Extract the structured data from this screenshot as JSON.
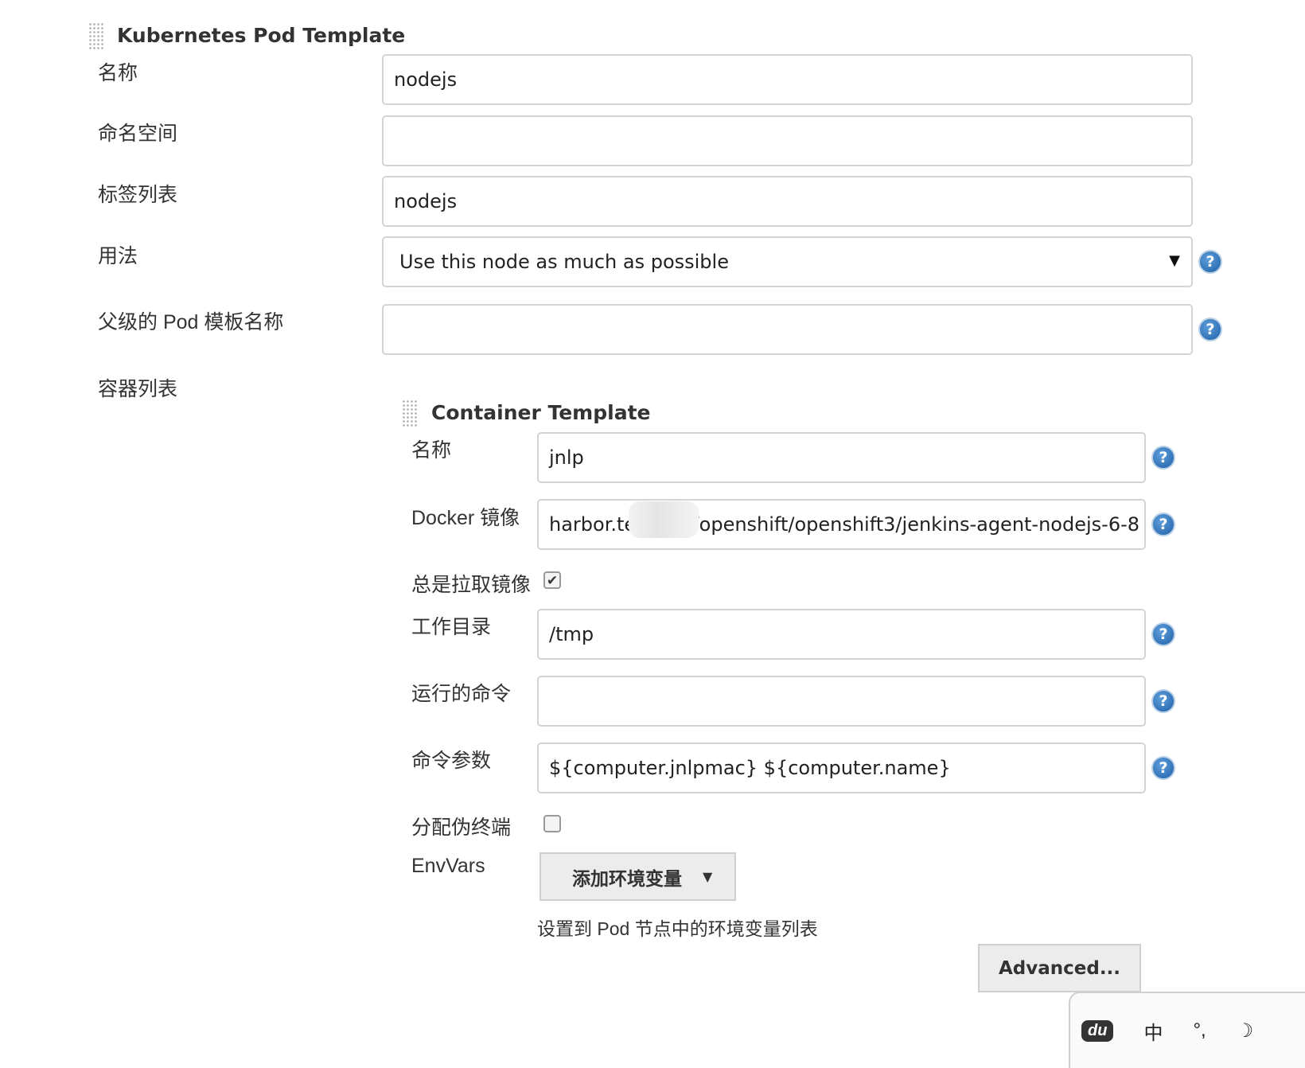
{
  "pod_template": {
    "title": "Kubernetes Pod Template",
    "name_label": "名称",
    "name_value": "nodejs",
    "namespace_label": "命名空间",
    "namespace_value": "",
    "labels_label": "标签列表",
    "labels_value": "nodejs",
    "usage_label": "用法",
    "usage_value": "Use this node as much as possible",
    "parent_label": "父级的 Pod 模板名称",
    "parent_value": "",
    "containers_label": "容器列表"
  },
  "container_template": {
    "title": "Container Template",
    "name_label": "名称",
    "name_value": "jnlp",
    "image_label": "Docker 镜像",
    "image_value": "harbor.tes        com/openshift/openshift3/jenkins-agent-nodejs-6-8",
    "always_pull_label": "总是拉取镜像",
    "always_pull_checked": true,
    "workdir_label": "工作目录",
    "workdir_value": "/tmp",
    "command_label": "运行的命令",
    "command_value": "",
    "args_label": "命令参数",
    "args_value": "${computer.jnlpmac} ${computer.name}",
    "tty_label": "分配伪终端",
    "tty_checked": false,
    "envvars_label": "EnvVars",
    "add_env_button": "添加环境变量",
    "envvars_help": "设置到 Pod 节点中的环境变量列表",
    "advanced_button": "Advanced..."
  },
  "help_glyph": "?",
  "icons": {
    "help": "question-circle-icon",
    "dropdown": "caret-down-icon",
    "grip": "drag-handle-icon"
  },
  "ime_bar": {
    "logo": "du",
    "mode": "中",
    "punct": "°,",
    "moon": "☽"
  },
  "colors": {
    "help_blue": "#2a6ebb",
    "border": "#d4d4d4",
    "button_bg": "#ececec"
  }
}
